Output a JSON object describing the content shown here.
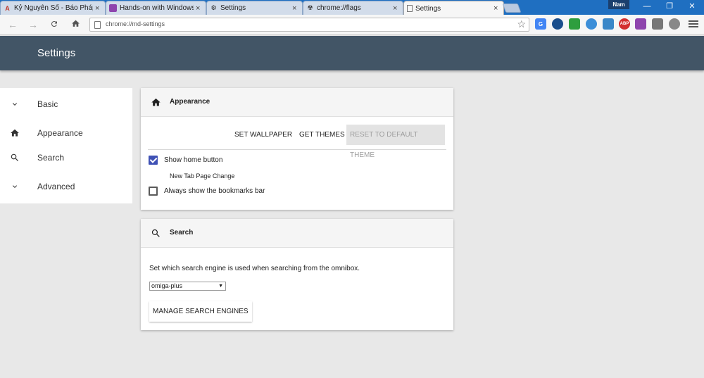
{
  "browser": {
    "tabs": [
      {
        "title": "Kỷ Nguyên Số - Báo Pháp",
        "icon": "news-favicon-icon"
      },
      {
        "title": "Hands-on with Windows",
        "icon": "site-favicon-icon"
      },
      {
        "title": "Settings",
        "icon": "gear-icon"
      },
      {
        "title": "chrome://flags",
        "icon": "flags-icon"
      },
      {
        "title": "Settings",
        "icon": "page-icon",
        "active": true
      }
    ],
    "profile_name": "Nam",
    "address": "chrome://md-settings",
    "extension_icons": [
      "google-translate-icon",
      "shield-icon",
      "evernote-icon",
      "cloud-icon",
      "camera-icon",
      "adblock-icon",
      "feather-icon",
      "copy-icon",
      "heart-icon"
    ],
    "adblock_label": "ABP"
  },
  "header": {
    "title": "Settings"
  },
  "sidebar": {
    "items": [
      {
        "label": "Basic",
        "icon": "chevron-down-icon"
      },
      {
        "label": "Appearance",
        "icon": "home-icon"
      },
      {
        "label": "Search",
        "icon": "search-icon"
      },
      {
        "label": "Advanced",
        "icon": "chevron-down-icon"
      }
    ]
  },
  "appearance": {
    "title": "Appearance",
    "set_wallpaper": "SET WALLPAPER",
    "get_themes": "GET THEMES",
    "reset_theme": "RESET TO DEFAULT THEME",
    "show_home_button": {
      "label": "Show home button",
      "checked": true
    },
    "home_page_option": "New Tab Page Change",
    "bookmarks_bar": {
      "label": "Always show the bookmarks bar",
      "checked": false
    }
  },
  "search": {
    "title": "Search",
    "description": "Set which search engine is used when searching from the omnibox.",
    "selected_engine": "omiga-plus",
    "manage_button": "MANAGE SEARCH ENGINES"
  },
  "colors": {
    "header_bg": "#425566",
    "checkbox_accent": "#3f51b5",
    "titlebar": "#1f6fc1"
  }
}
